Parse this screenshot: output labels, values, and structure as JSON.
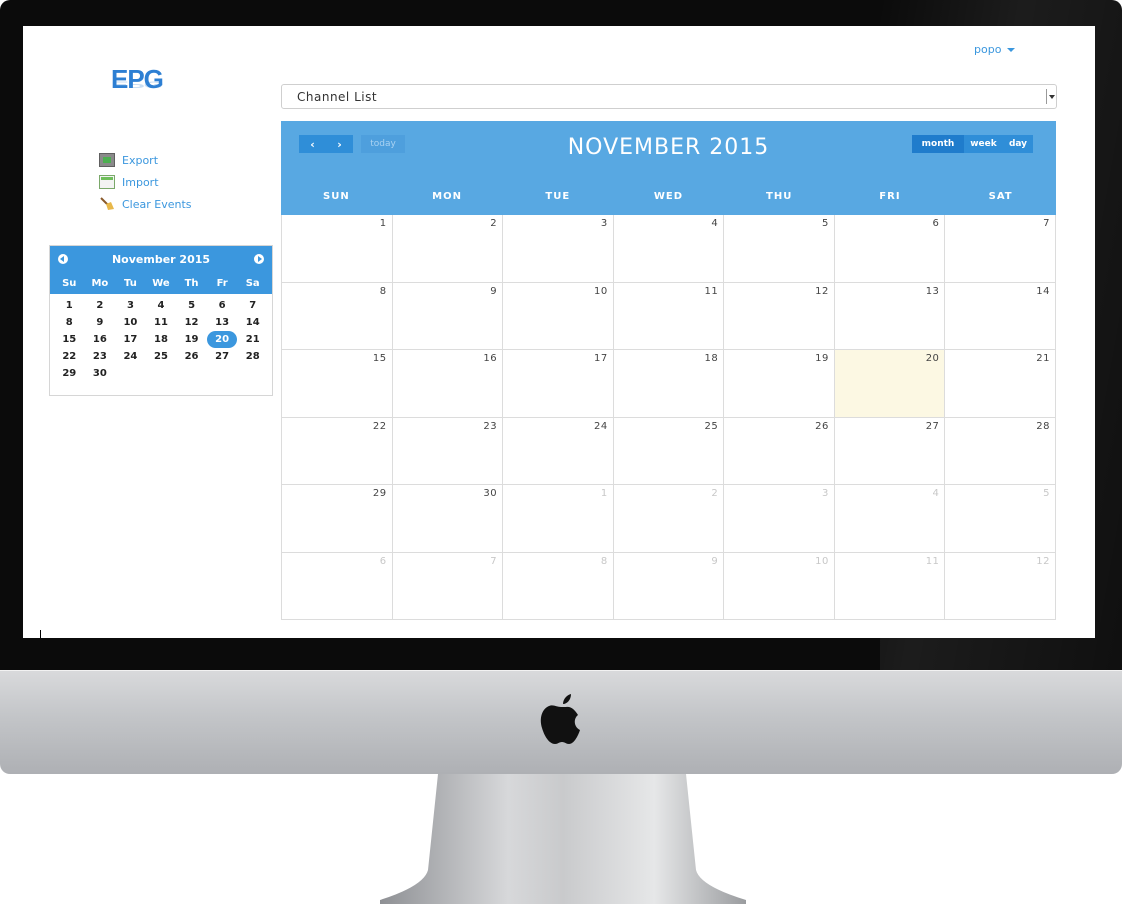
{
  "user_menu": {
    "name": "popo"
  },
  "logo": {
    "text": "EPG"
  },
  "actions": [
    {
      "label": "Export",
      "icon": "export-icon"
    },
    {
      "label": "Import",
      "icon": "import-icon"
    },
    {
      "label": "Clear Events",
      "icon": "broom-icon"
    }
  ],
  "channel_select": {
    "selected": "Channel List"
  },
  "mini_calendar": {
    "title": "November 2015",
    "days_of_week": [
      "Su",
      "Mo",
      "Tu",
      "We",
      "Th",
      "Fr",
      "Sa"
    ],
    "weeks": [
      [
        "1",
        "2",
        "3",
        "4",
        "5",
        "6",
        "7"
      ],
      [
        "8",
        "9",
        "10",
        "11",
        "12",
        "13",
        "14"
      ],
      [
        "15",
        "16",
        "17",
        "18",
        "19",
        "20",
        "21"
      ],
      [
        "22",
        "23",
        "24",
        "25",
        "26",
        "27",
        "28"
      ],
      [
        "29",
        "30",
        "",
        "",
        "",
        "",
        ""
      ]
    ],
    "selected_day": "20"
  },
  "calendar": {
    "title": "NOVEMBER 2015",
    "prev_label": "‹",
    "next_label": "›",
    "today_label": "today",
    "views": {
      "month": "month",
      "week": "week",
      "day": "day"
    },
    "active_view": "month",
    "days_of_week": [
      "SUN",
      "MON",
      "TUE",
      "WED",
      "THU",
      "FRI",
      "SAT"
    ],
    "weeks": [
      [
        {
          "n": "1"
        },
        {
          "n": "2"
        },
        {
          "n": "3"
        },
        {
          "n": "4"
        },
        {
          "n": "5"
        },
        {
          "n": "6"
        },
        {
          "n": "7"
        }
      ],
      [
        {
          "n": "8"
        },
        {
          "n": "9"
        },
        {
          "n": "10"
        },
        {
          "n": "11"
        },
        {
          "n": "12"
        },
        {
          "n": "13"
        },
        {
          "n": "14"
        }
      ],
      [
        {
          "n": "15"
        },
        {
          "n": "16"
        },
        {
          "n": "17"
        },
        {
          "n": "18"
        },
        {
          "n": "19"
        },
        {
          "n": "20",
          "today": true
        },
        {
          "n": "21"
        }
      ],
      [
        {
          "n": "22"
        },
        {
          "n": "23"
        },
        {
          "n": "24"
        },
        {
          "n": "25"
        },
        {
          "n": "26"
        },
        {
          "n": "27"
        },
        {
          "n": "28"
        }
      ],
      [
        {
          "n": "29"
        },
        {
          "n": "30"
        },
        {
          "n": "1",
          "other": true
        },
        {
          "n": "2",
          "other": true
        },
        {
          "n": "3",
          "other": true
        },
        {
          "n": "4",
          "other": true
        },
        {
          "n": "5",
          "other": true
        }
      ],
      [
        {
          "n": "6",
          "other": true
        },
        {
          "n": "7",
          "other": true
        },
        {
          "n": "8",
          "other": true
        },
        {
          "n": "9",
          "other": true
        },
        {
          "n": "10",
          "other": true
        },
        {
          "n": "11",
          "other": true
        },
        {
          "n": "12",
          "other": true
        }
      ]
    ]
  },
  "colors": {
    "accent": "#3b97de",
    "header": "#58a8e2",
    "today_highlight": "#fcf8e3"
  }
}
